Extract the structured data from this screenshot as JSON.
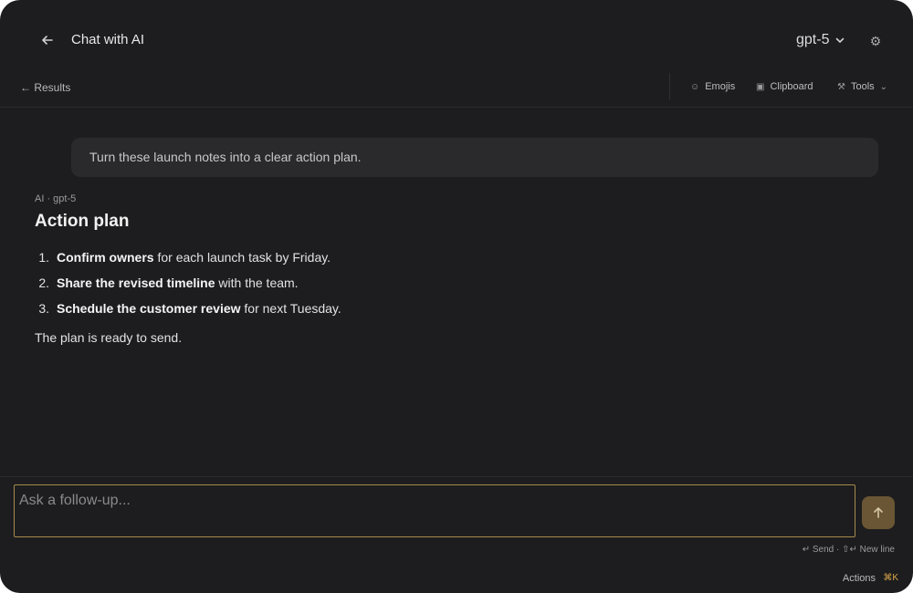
{
  "header": {
    "title": "Chat with AI",
    "model": "gpt-5",
    "back_icon": "arrow-left-icon",
    "settings_icon": "gear-icon"
  },
  "toolbar": {
    "results_label": "← Results",
    "emojis_label": "Emojis",
    "clipboard_label": "Clipboard",
    "tools_label": "Tools"
  },
  "conversation": {
    "user_message": "Turn these launch notes into a clear action plan.",
    "ai_meta": "AI · gpt-5",
    "ai_heading": "Action plan",
    "ai_items": [
      {
        "num": "1.",
        "bold": "Confirm owners",
        "rest": " for each launch task by Friday."
      },
      {
        "num": "2.",
        "bold": "Share the revised timeline",
        "rest": " with the team."
      },
      {
        "num": "3.",
        "bold": "Schedule the customer review",
        "rest": " for next Tuesday."
      }
    ],
    "ai_closing": "The plan is ready to send."
  },
  "composer": {
    "placeholder": "Ask a follow-up...",
    "hint": "↵ Send · ⇧↵ New line",
    "actions_label": "Actions",
    "actions_shortcut": "⌘K"
  },
  "colors": {
    "background": "#1d1d1f",
    "accent": "#a68a4c",
    "send_button": "#6a5634"
  }
}
